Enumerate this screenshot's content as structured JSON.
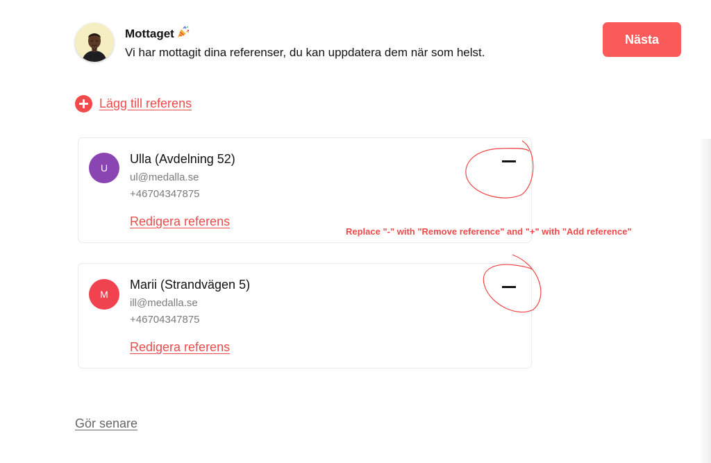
{
  "header": {
    "title": "Mottaget",
    "subtitle": "Vi har mottagit dina referenser, du kan uppdatera dem när som helst.",
    "next_label": "Nästa"
  },
  "add_reference": {
    "label": "Lägg till referens",
    "icon": "plus-circle-icon"
  },
  "references": [
    {
      "initial": "U",
      "name": "Ulla (Avdelning 52)",
      "email": "ul@medalla.se",
      "phone": "+46704347875",
      "edit_label": "Redigera referens",
      "avatar_color": "#8b45b3"
    },
    {
      "initial": "M",
      "name": "Marii (Strandvägen 5)",
      "email": "ill@medalla.se",
      "phone": "+46704347875",
      "edit_label": "Redigera referens",
      "avatar_color": "#f0424f"
    }
  ],
  "annotation": {
    "text": "Replace \"-\" with \"Remove reference\" and \"+\" with \"Add reference\"",
    "color": "#f04848"
  },
  "later_label": "Gör senare",
  "colors": {
    "accent": "#fa5a5a",
    "link": "#ee4a4a"
  }
}
